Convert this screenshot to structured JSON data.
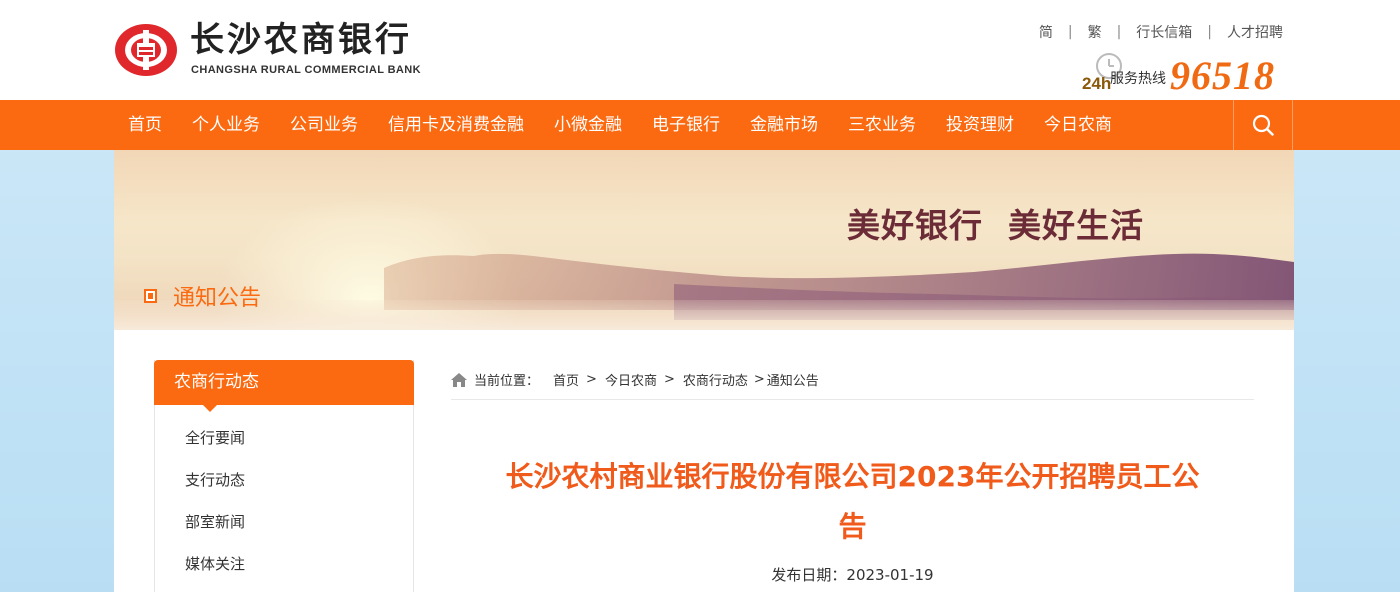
{
  "brand": {
    "name_cn": "长沙农商银行",
    "name_en": "CHANGSHA RURAL COMMERCIAL BANK",
    "brand_color": "#fb6a10"
  },
  "top_links": [
    "简",
    "繁",
    "行长信箱",
    "人才招聘"
  ],
  "hotline": {
    "prefix": "24h",
    "label": "服务热线",
    "number": "96518"
  },
  "nav": {
    "items": [
      "首页",
      "个人业务",
      "公司业务",
      "信用卡及消费金融",
      "小微金融",
      "电子银行",
      "金融市场",
      "三农业务",
      "投资理财",
      "今日农商"
    ],
    "search_icon": "search-icon"
  },
  "banner": {
    "slogan": "美好银行  美好生活",
    "section_title": "通知公告"
  },
  "sidebar": {
    "title": "农商行动态",
    "items": [
      "全行要闻",
      "支行动态",
      "部室新闻",
      "媒体关注"
    ]
  },
  "breadcrumb": {
    "label": "当前位置：",
    "items": [
      "首页",
      "今日农商",
      "农商行动态",
      "通知公告"
    ]
  },
  "article": {
    "title": "长沙农村商业银行股份有限公司2023年公开招聘员工公告",
    "date_label": "发布日期：",
    "date": "2023-01-19"
  }
}
